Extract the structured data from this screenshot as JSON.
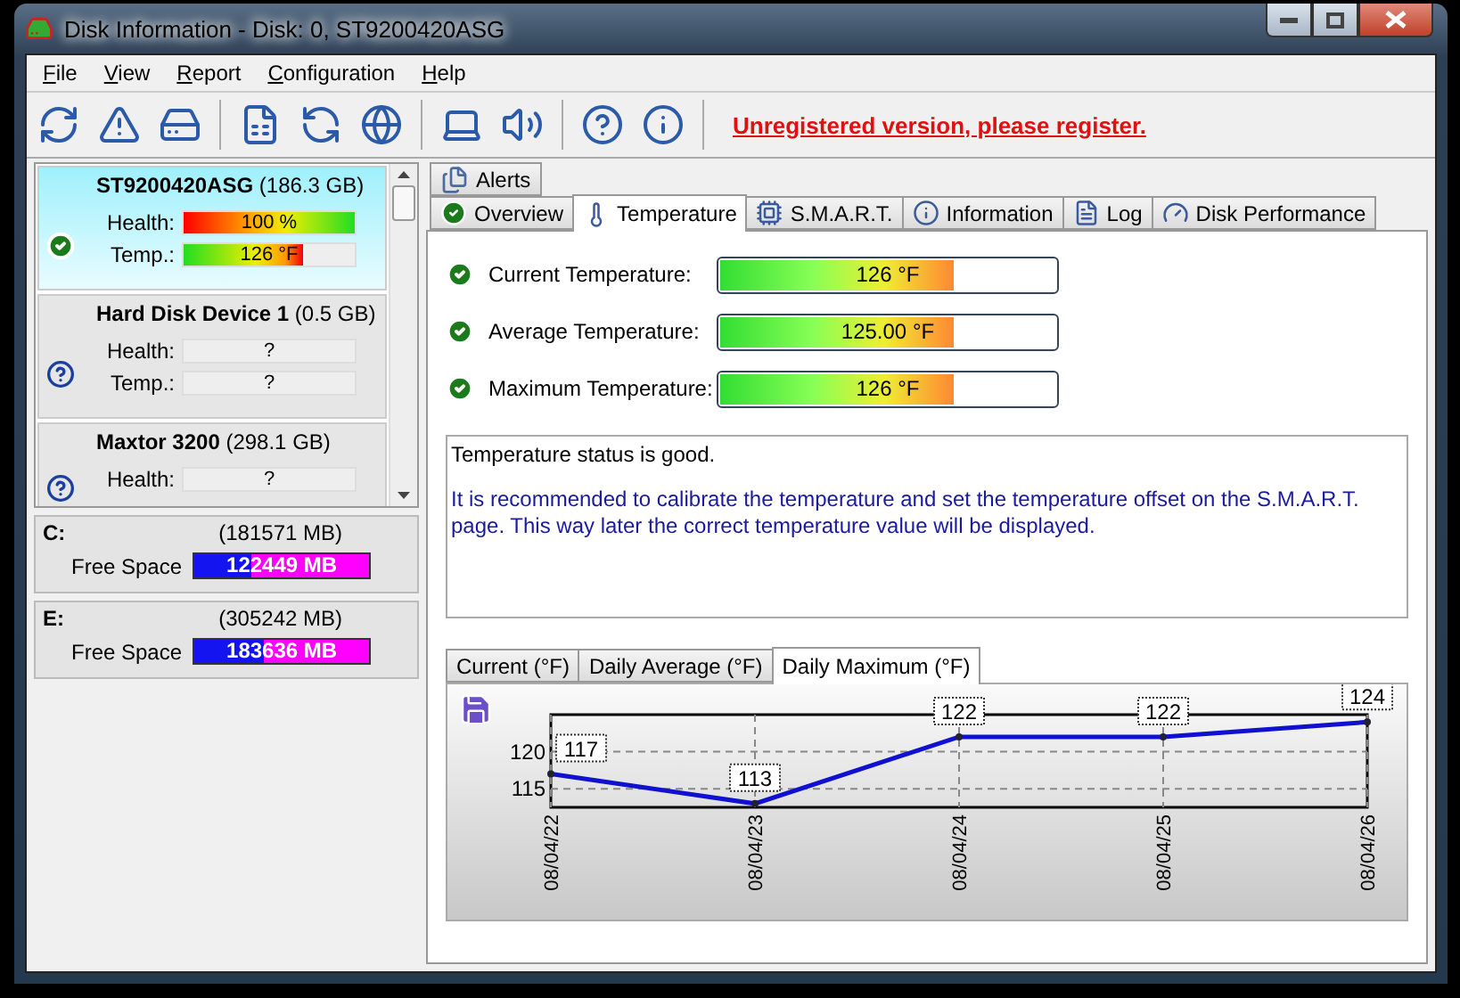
{
  "window": {
    "title": "Disk Information - Disk: 0, ST9200420ASG"
  },
  "menu": [
    {
      "label": "File"
    },
    {
      "label": "View"
    },
    {
      "label": "Report"
    },
    {
      "label": "Configuration"
    },
    {
      "label": "Help"
    }
  ],
  "toolbar": {
    "link": "Unregistered version, please register."
  },
  "disks": [
    {
      "name": "**ST9200420ASG** (186.3 GB)",
      "selected": true,
      "ok": true,
      "rows": [
        {
          "label": "Health:",
          "kind": "health",
          "value": "100 %",
          "level": 1
        },
        {
          "label": "Temp.:",
          "kind": "temp",
          "value": "126 °F",
          "level": 0.7
        }
      ]
    },
    {
      "name": "**Hard Disk Device 1** (0.5 GB)",
      "selected": false,
      "ok": false,
      "rows": [
        {
          "label": "Health:",
          "value": "?"
        },
        {
          "label": "Temp.:",
          "value": "?"
        }
      ]
    },
    {
      "name": "**Maxtor  3200** (298.1 GB)",
      "selected": false,
      "ok": false,
      "rows": [
        {
          "label": "Health:",
          "value": "?"
        }
      ]
    }
  ],
  "drives": [
    {
      "letter": "C:",
      "size": "(181571 MB)",
      "free_label": "Free Space",
      "free": "122449 MB",
      "level": 0.33
    },
    {
      "letter": "E:",
      "size": "(305242 MB)",
      "free_label": "Free Space",
      "free": "183636 MB",
      "level": 0.4
    }
  ],
  "alert_tabs": [
    {
      "label": "Alerts",
      "selected": false
    }
  ],
  "tabs": [
    {
      "label": "Overview",
      "selected": false
    },
    {
      "label": "Temperature",
      "selected": true
    },
    {
      "label": "S.M.A.R.T.",
      "selected": false
    },
    {
      "label": "Information",
      "selected": false
    },
    {
      "label": "Log",
      "selected": false
    },
    {
      "label": "Disk Performance",
      "selected": false
    }
  ],
  "temperatures": [
    {
      "label": "Current Temperature:",
      "value": "126 °F",
      "level": 0.7,
      "ok": true
    },
    {
      "label": "Average Temperature:",
      "value": "125.00 °F",
      "level": 0.7,
      "ok": true
    },
    {
      "label": "Maximum Temperature:",
      "value": "126 °F",
      "level": 0.7,
      "ok": true
    }
  ],
  "message": {
    "status": "Temperature status is good.",
    "advice": "It is recommended to calibrate the temperature and set the temperature offset on the S.M.A.R.T. page. This way later the correct temperature value will be displayed."
  },
  "chart_tabs": [
    {
      "label": "Current (°F)",
      "selected": false
    },
    {
      "label": "Daily Average (°F)",
      "selected": false
    },
    {
      "label": "Daily Maximum (°F)",
      "selected": true
    }
  ],
  "chart_data": {
    "type": "line",
    "categories": [
      "08/04/22",
      "08/04/23",
      "08/04/24",
      "08/04/25",
      "08/04/26"
    ],
    "series": [
      {
        "color": "#1010d0",
        "marker": "circle",
        "values": [
          117,
          113,
          122,
          122,
          124
        ]
      }
    ],
    "ylim": [
      112.5,
      125
    ],
    "yticks": [
      115,
      120
    ],
    "grid": true,
    "data_labels": true
  }
}
